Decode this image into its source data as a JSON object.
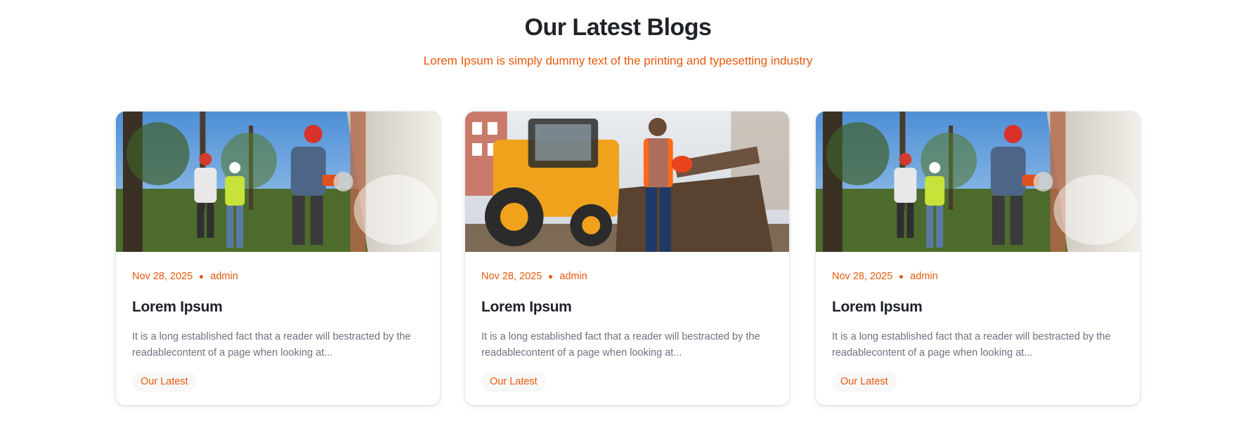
{
  "section": {
    "title": "Our Latest Blogs",
    "subtitle": "Lorem Ipsum is simply dummy text of the printing and typesetting industry"
  },
  "colors": {
    "accent": "#e8590c",
    "title": "#1f2328",
    "body_text": "#6b7280",
    "button_bg": "#f8f8f8"
  },
  "cards": [
    {
      "image_icon": "construction-workers-photo",
      "date": "Nov 28, 2025",
      "author": "admin",
      "title": "Lorem Ipsum",
      "excerpt": "It is a long established fact that a reader will bestracted by the readablecontent of a page when looking at...",
      "button_label": "Our Latest"
    },
    {
      "image_icon": "backhoe-loader-photo",
      "date": "Nov 28, 2025",
      "author": "admin",
      "title": "Lorem Ipsum",
      "excerpt": "It is a long established fact that a reader will bestracted by the readablecontent of a page when looking at...",
      "button_label": "Our Latest"
    },
    {
      "image_icon": "construction-workers-photo",
      "date": "Nov 28, 2025",
      "author": "admin",
      "title": "Lorem Ipsum",
      "excerpt": "It is a long established fact that a reader will bestracted by the readablecontent of a page when looking at...",
      "button_label": "Our Latest"
    }
  ]
}
